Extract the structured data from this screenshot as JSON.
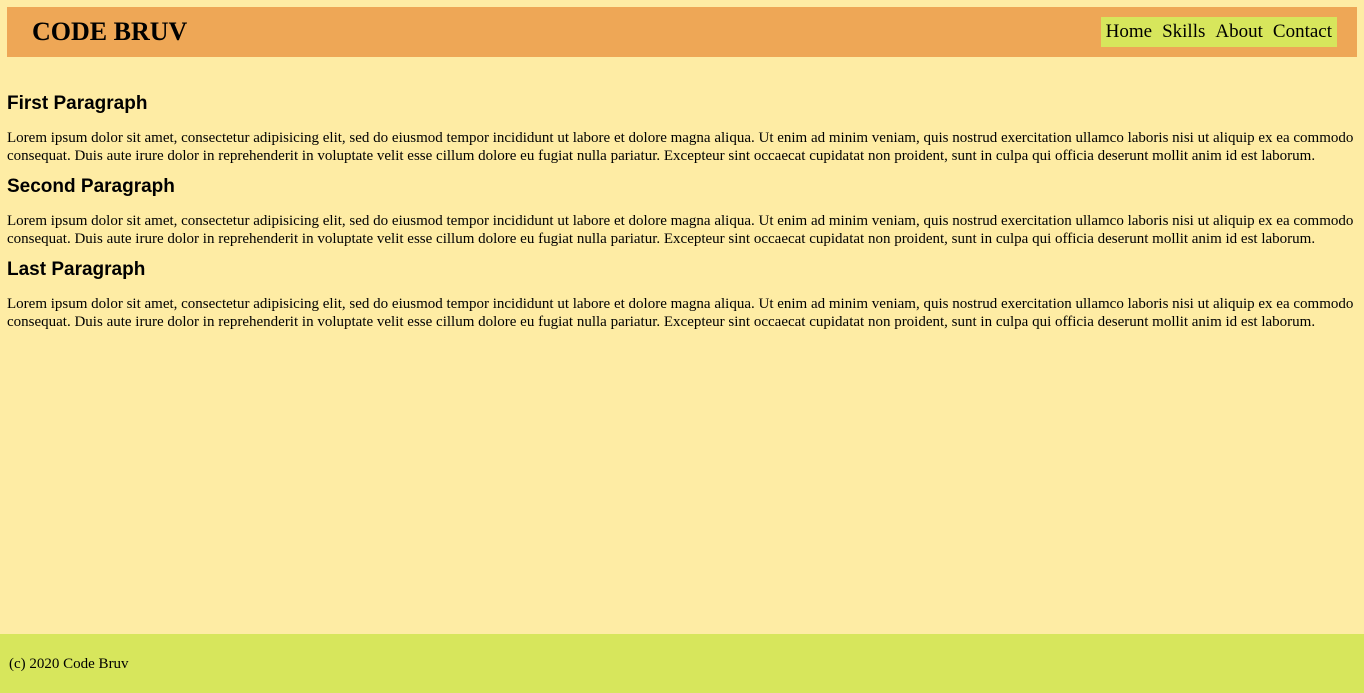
{
  "header": {
    "logo": "CODE BRUV",
    "nav": [
      "Home",
      "Skills",
      "About",
      "Contact"
    ]
  },
  "sections": [
    {
      "title": "First Paragraph",
      "body": "Lorem ipsum dolor sit amet, consectetur adipisicing elit, sed do eiusmod tempor incididunt ut labore et dolore magna aliqua. Ut enim ad minim veniam, quis nostrud exercitation ullamco laboris nisi ut aliquip ex ea commodo consequat. Duis aute irure dolor in reprehenderit in voluptate velit esse cillum dolore eu fugiat nulla pariatur. Excepteur sint occaecat cupidatat non proident, sunt in culpa qui officia deserunt mollit anim id est laborum."
    },
    {
      "title": "Second Paragraph",
      "body": "Lorem ipsum dolor sit amet, consectetur adipisicing elit, sed do eiusmod tempor incididunt ut labore et dolore magna aliqua. Ut enim ad minim veniam, quis nostrud exercitation ullamco laboris nisi ut aliquip ex ea commodo consequat. Duis aute irure dolor in reprehenderit in voluptate velit esse cillum dolore eu fugiat nulla pariatur. Excepteur sint occaecat cupidatat non proident, sunt in culpa qui officia deserunt mollit anim id est laborum."
    },
    {
      "title": "Last Paragraph",
      "body": "Lorem ipsum dolor sit amet, consectetur adipisicing elit, sed do eiusmod tempor incididunt ut labore et dolore magna aliqua. Ut enim ad minim veniam, quis nostrud exercitation ullamco laboris nisi ut aliquip ex ea commodo consequat. Duis aute irure dolor in reprehenderit in voluptate velit esse cillum dolore eu fugiat nulla pariatur. Excepteur sint occaecat cupidatat non proident, sunt in culpa qui officia deserunt mollit anim id est laborum."
    }
  ],
  "footer": {
    "text": "(c) 2020 Code Bruv"
  },
  "colors": {
    "page_background": "#feeca4",
    "header_background": "#eea756",
    "nav_background": "#d7e65c",
    "footer_background": "#d7e65c"
  }
}
